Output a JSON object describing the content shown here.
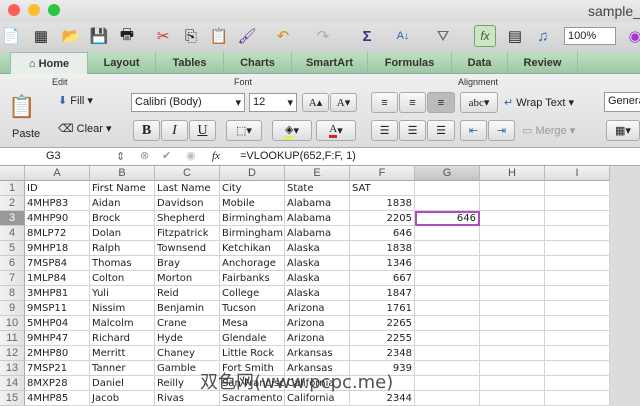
{
  "window": {
    "title": "sample_"
  },
  "toolbar": {
    "zoom": "100%"
  },
  "tabs": [
    "Home",
    "Layout",
    "Tables",
    "Charts",
    "SmartArt",
    "Formulas",
    "Data",
    "Review"
  ],
  "ribbon": {
    "edit_label": "Edit",
    "font_label": "Font",
    "alignment_label": "Alignment",
    "paste": "Paste",
    "fill": "Fill",
    "clear": "Clear",
    "font_name": "Calibri (Body)",
    "font_size": "12",
    "bold": "B",
    "italic": "I",
    "underline": "U",
    "abc": "abc",
    "wrap_text": "Wrap Text",
    "merge": "Merge",
    "number_format": "General"
  },
  "formula_bar": {
    "name_box": "G3",
    "fx": "fx",
    "formula": "=VLOOKUP(652,F:F, 1)"
  },
  "columns": [
    "A",
    "B",
    "C",
    "D",
    "E",
    "F",
    "G",
    "H",
    "I"
  ],
  "rows": [
    [
      "ID",
      "First Name",
      "Last Name",
      "City",
      "State",
      "SAT",
      ""
    ],
    [
      "4MHP83",
      "Aidan",
      "Davidson",
      "Mobile",
      "Alabama",
      "1838",
      ""
    ],
    [
      "4MHP90",
      "Brock",
      "Shepherd",
      "Birmingham",
      "Alabama",
      "2205",
      "646"
    ],
    [
      "8MLP72",
      "Dolan",
      "Fitzpatrick",
      "Birmingham",
      "Alabama",
      "646",
      ""
    ],
    [
      "9MHP18",
      "Ralph",
      "Townsend",
      "Ketchikan",
      "Alaska",
      "1838",
      ""
    ],
    [
      "7MSP84",
      "Thomas",
      "Bray",
      "Anchorage",
      "Alaska",
      "1346",
      ""
    ],
    [
      "1MLP84",
      "Colton",
      "Morton",
      "Fairbanks",
      "Alaska",
      "667",
      ""
    ],
    [
      "3MHP81",
      "Yuli",
      "Reid",
      "College",
      "Alaska",
      "1847",
      ""
    ],
    [
      "9MSP11",
      "Nissim",
      "Benjamin",
      "Tucson",
      "Arizona",
      "1761",
      ""
    ],
    [
      "5MHP04",
      "Malcolm",
      "Crane",
      "Mesa",
      "Arizona",
      "2265",
      ""
    ],
    [
      "9MHP47",
      "Richard",
      "Hyde",
      "Glendale",
      "Arizona",
      "2255",
      ""
    ],
    [
      "2MHP80",
      "Merritt",
      "Chaney",
      "Little Rock",
      "Arkansas",
      "2348",
      ""
    ],
    [
      "7MSP21",
      "Tanner",
      "Gamble",
      "Fort Smith",
      "Arkansas",
      "939",
      ""
    ],
    [
      "8MXP28",
      "Daniel",
      "Reilly",
      "San Francisco",
      "California",
      "",
      ""
    ],
    [
      "4MHP85",
      "Jacob",
      "Rivas",
      "Sacramento",
      "California",
      "2344",
      ""
    ]
  ],
  "watermark": "双色网(www.pcpc.me)"
}
